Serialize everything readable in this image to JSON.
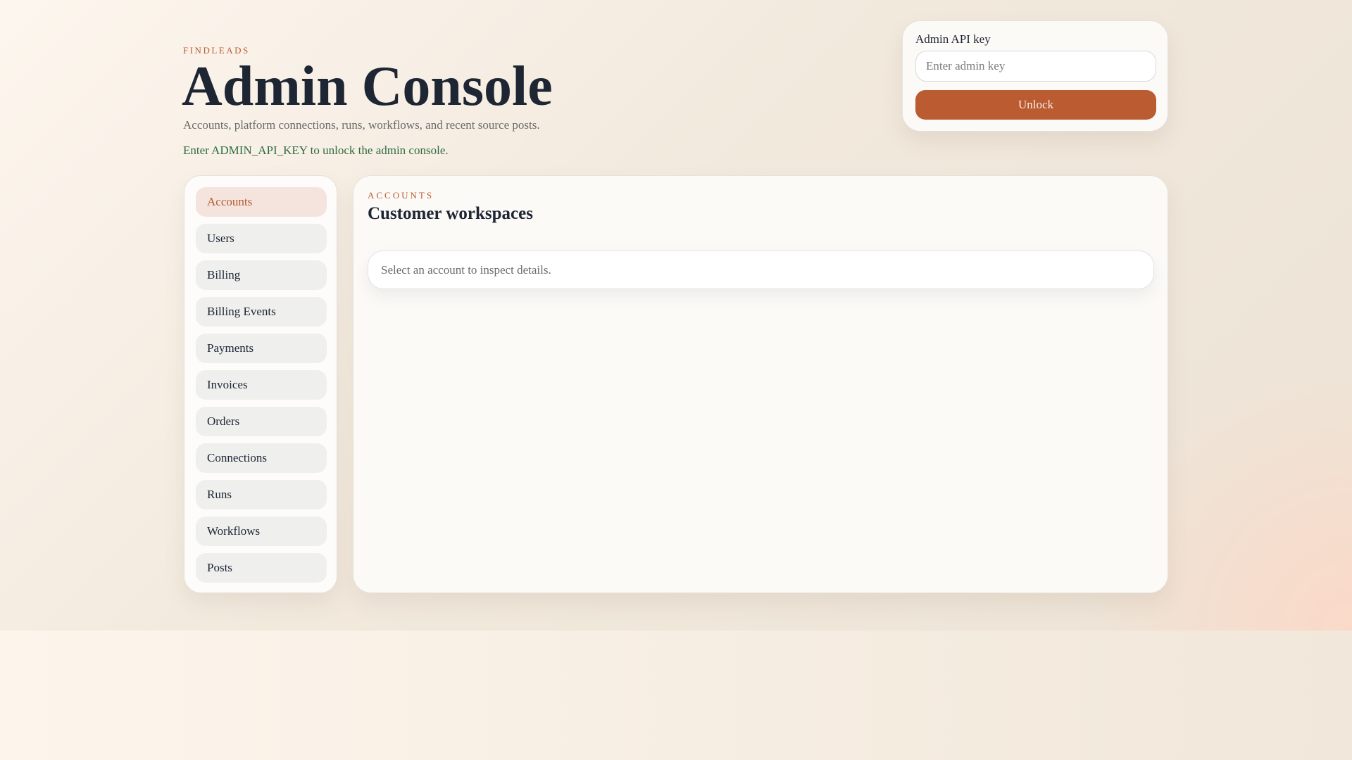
{
  "header": {
    "brand": "FINDLEADS",
    "title": "Admin Console",
    "subtitle": "Accounts, platform connections, runs, workflows, and recent source posts.",
    "hint": "Enter ADMIN_API_KEY to unlock the admin console."
  },
  "auth": {
    "label": "Admin API key",
    "placeholder": "Enter admin key",
    "value": "",
    "unlock_label": "Unlock"
  },
  "sidebar": {
    "items": [
      {
        "label": "Accounts",
        "active": true
      },
      {
        "label": "Users"
      },
      {
        "label": "Billing"
      },
      {
        "label": "Billing Events"
      },
      {
        "label": "Payments"
      },
      {
        "label": "Invoices"
      },
      {
        "label": "Orders"
      },
      {
        "label": "Connections"
      },
      {
        "label": "Runs"
      },
      {
        "label": "Workflows"
      },
      {
        "label": "Posts"
      }
    ]
  },
  "main": {
    "eyebrow": "ACCOUNTS",
    "title": "Customer workspaces",
    "empty_text": "Select an account to inspect details."
  },
  "colors": {
    "accent": "#ba5b32",
    "success_text": "#2f6b3e"
  }
}
